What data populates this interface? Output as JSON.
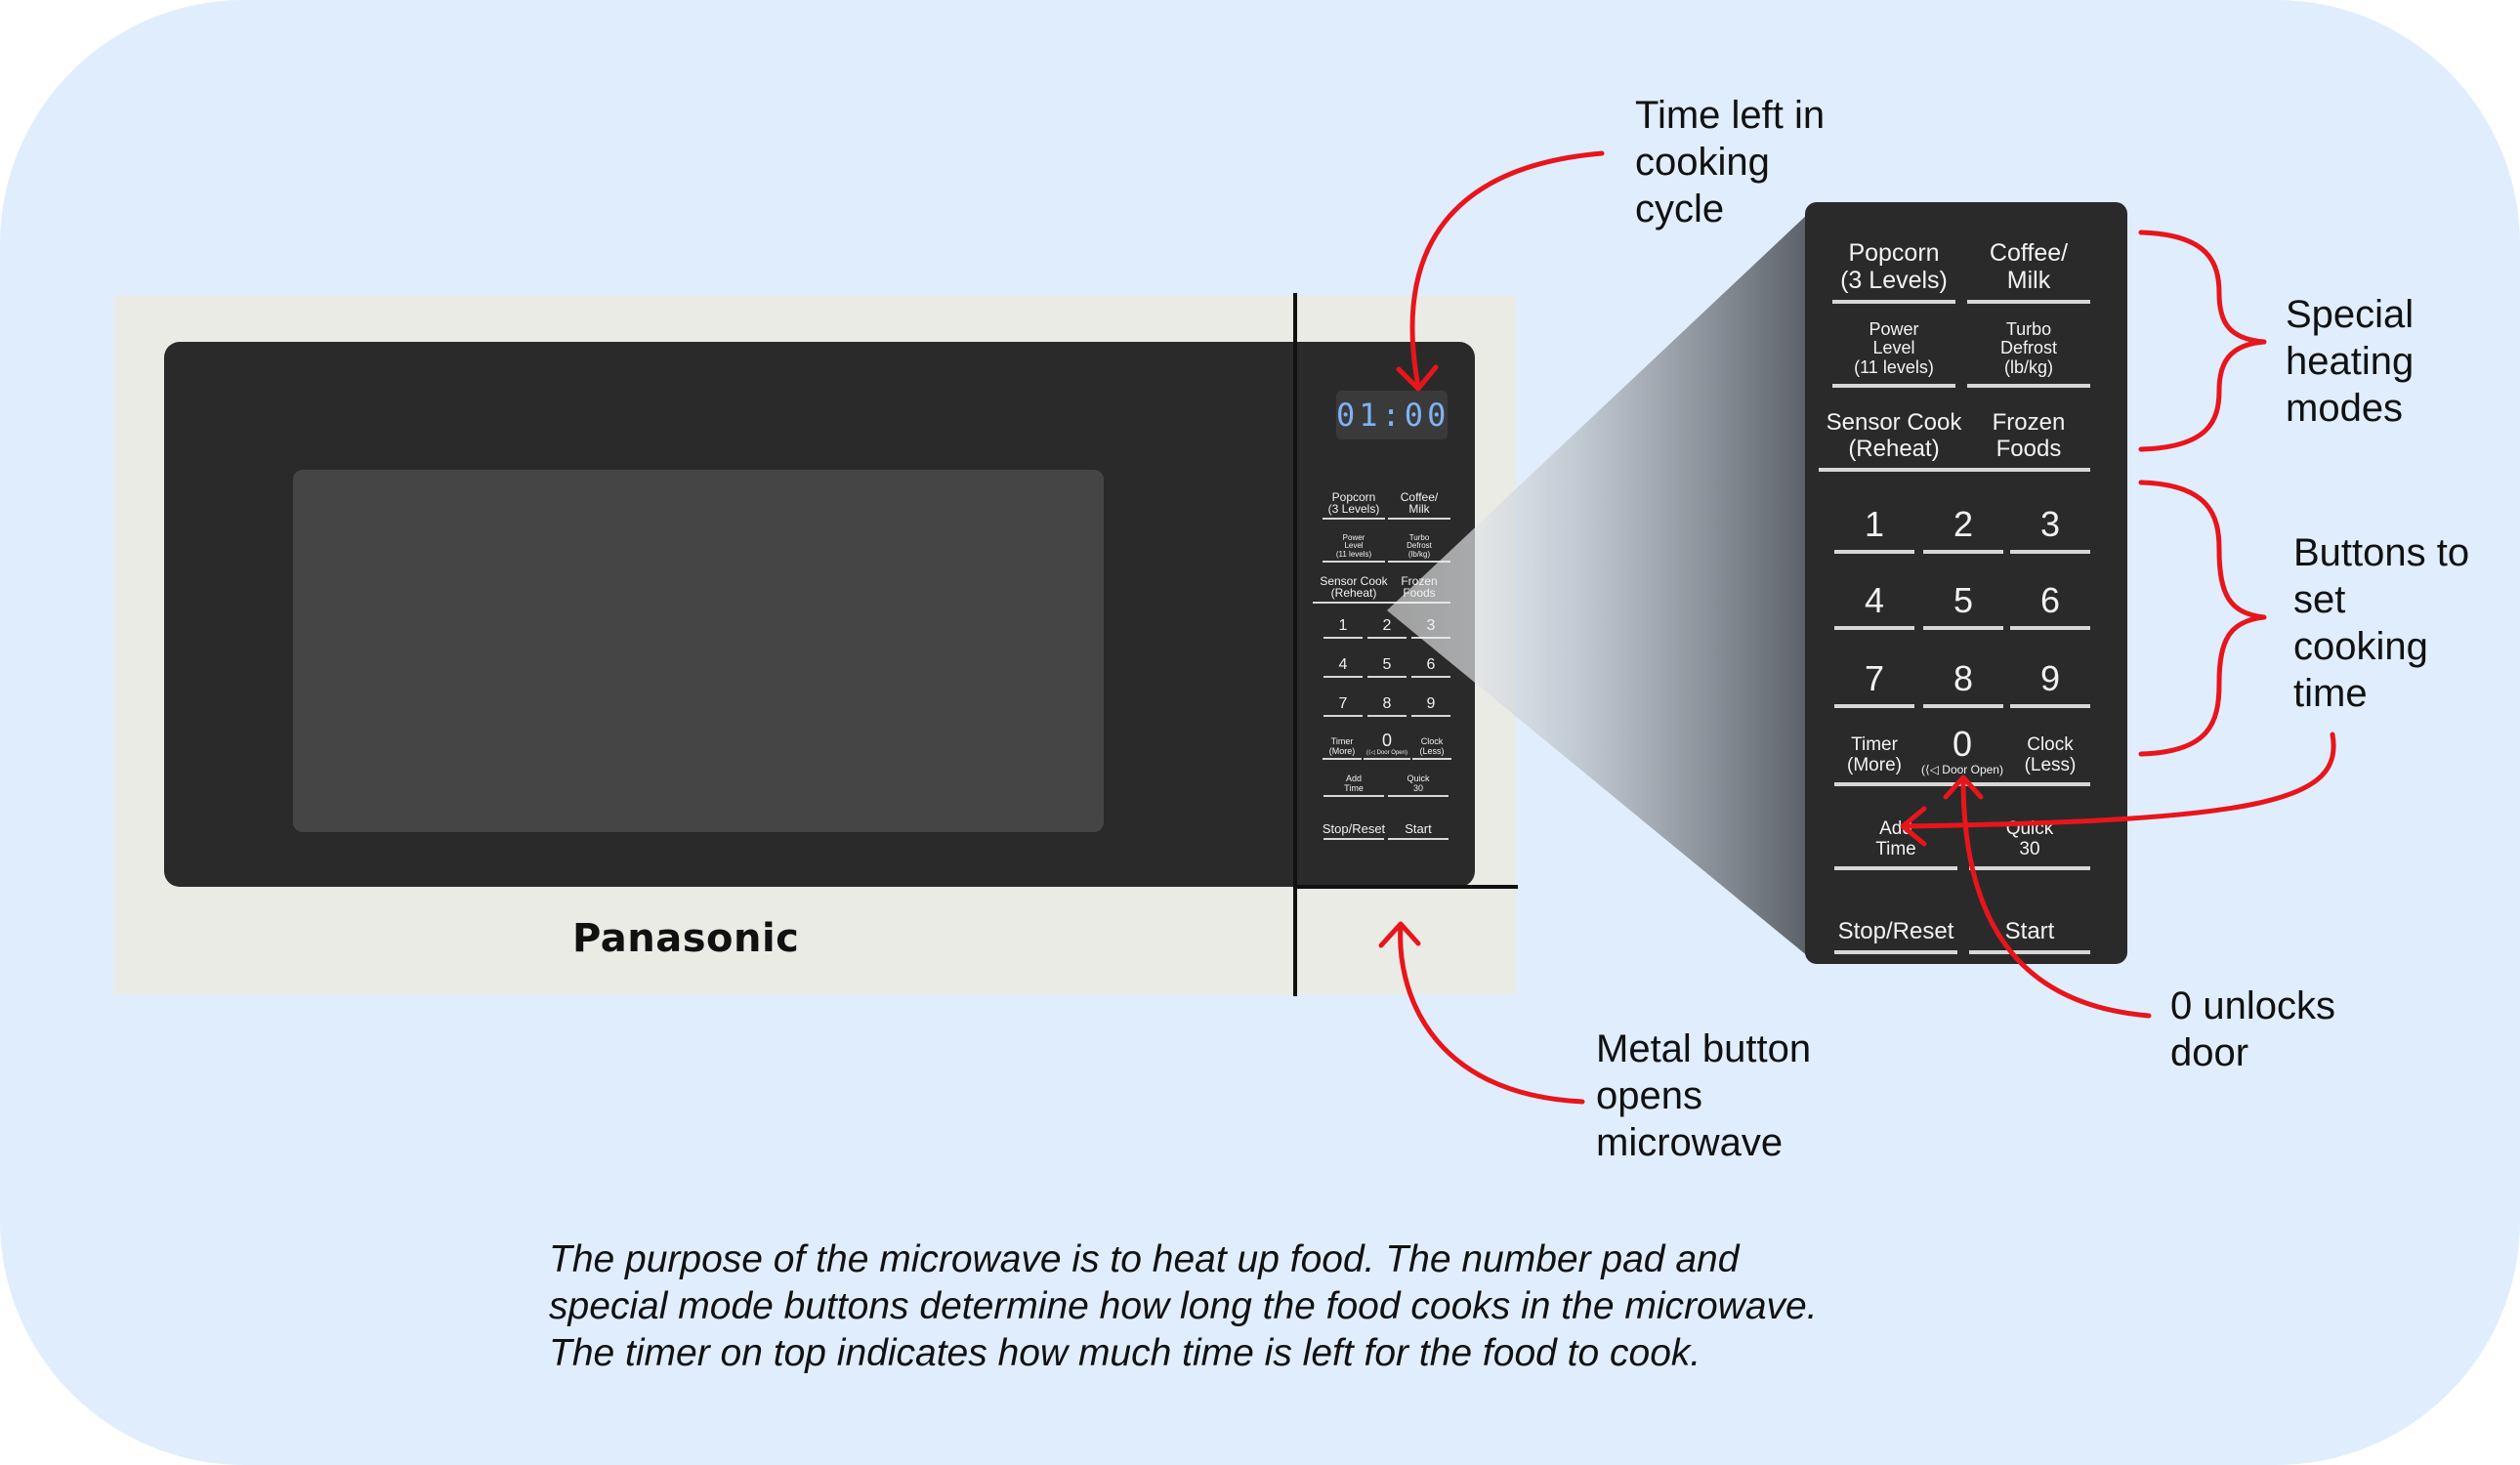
{
  "microwave": {
    "brand": "Panasonic",
    "display": "01:00"
  },
  "keypad": {
    "special_keys": [
      [
        "Popcorn",
        "(3 Levels)"
      ],
      [
        "Coffee/",
        "Milk"
      ],
      [
        "Power",
        "Level",
        "(11 levels)"
      ],
      [
        "Turbo",
        "Defrost",
        "(lb/kg)"
      ],
      [
        "Sensor Cook",
        "(Reheat)"
      ],
      [
        "Frozen",
        "Foods"
      ]
    ],
    "digits": [
      "1",
      "2",
      "3",
      "4",
      "5",
      "6",
      "7",
      "8",
      "9"
    ],
    "timer": [
      "Timer",
      "(More)"
    ],
    "zero": "0",
    "door_open": "(⟨◁ Door Open)",
    "clock": [
      "Clock",
      "(Less)"
    ],
    "add_time": [
      "Add",
      "Time"
    ],
    "quick": [
      "Quick",
      "30"
    ],
    "stop_reset": "Stop/Reset",
    "start": "Start"
  },
  "annotations": {
    "time_left": "Time left in\ncooking\ncycle",
    "special_modes": "Special\nheating\nmodes",
    "set_time": "Buttons to\nset\ncooking\ntime",
    "unlock": "0 unlocks\ndoor",
    "metal_button": "Metal button\nopens\nmicrowave"
  },
  "caption": [
    "The purpose of the microwave is to heat up food. The number pad and",
    "special mode buttons determine how long the food cooks in the microwave.",
    "The timer on top indicates how much time is left for the food to cook."
  ],
  "colors": {
    "background": "#dfedfd",
    "microwave_body": "#ebebe6",
    "panel": "#2a2a2a",
    "display_digits": "#7fb2f5",
    "arrows": "#e8151b"
  }
}
